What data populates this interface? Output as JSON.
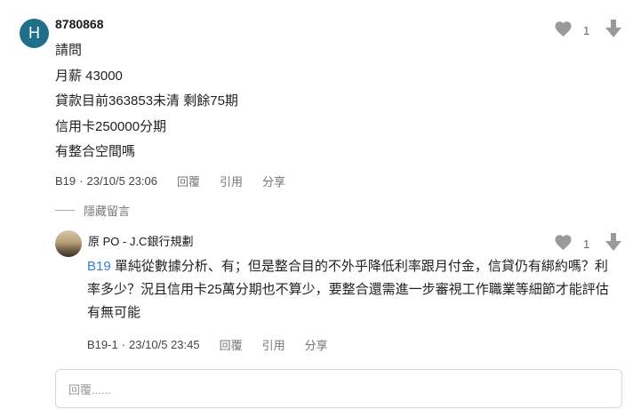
{
  "comment": {
    "avatar_letter": "H",
    "avatar_color": "#1f6f8b",
    "username": "8780868",
    "lines": [
      "請問",
      "月薪 43000",
      "貸款目前363853未清 剩餘75期",
      "信用卡250000分期",
      "有整合空間嗎"
    ],
    "floor": "B19",
    "timestamp": "23/10/5 23:06",
    "actions": {
      "reply": "回覆",
      "quote": "引用",
      "share": "分享"
    },
    "likes": "1"
  },
  "hidden_toggle": "隱藏留言",
  "reply": {
    "author": "原 PO - J.C銀行規劃",
    "ref_tag": "B19",
    "text": " 單純從數據分析、有；但是整合目的不外乎降低利率跟月付金，信貸仍有綁約嗎？利率多少？況且信用卡25萬分期也不算少，要整合還需進一步審視工作職業等細節才能評估有無可能",
    "floor": "B19-1",
    "timestamp": "23/10/5 23:45",
    "actions": {
      "reply": "回覆",
      "quote": "引用",
      "share": "分享"
    },
    "likes": "1"
  },
  "reply_input": {
    "placeholder": "回覆......"
  },
  "colors": {
    "link": "#3a7bd5",
    "icon": "#9a9a9a"
  }
}
